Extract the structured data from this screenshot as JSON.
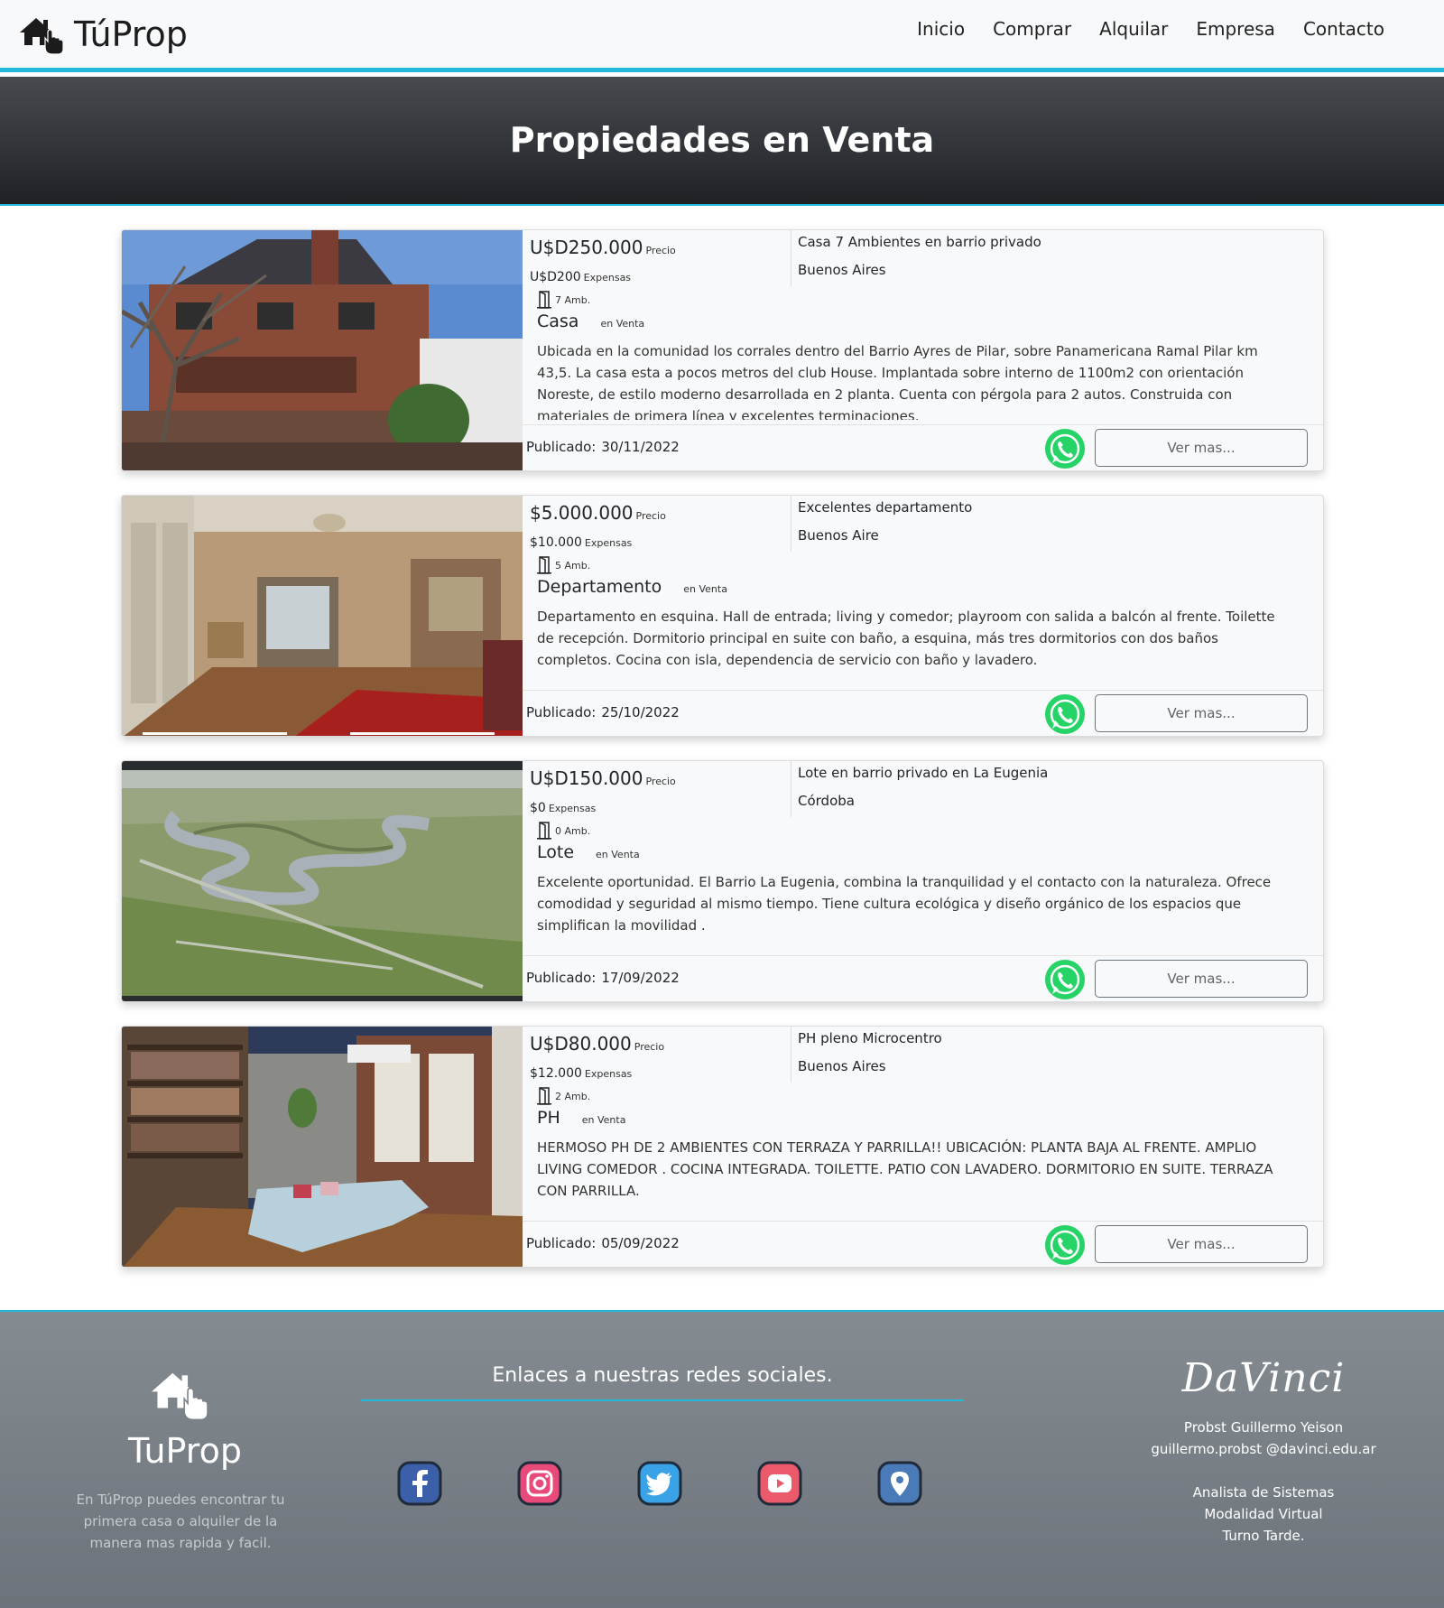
{
  "brand": {
    "name": "TúProp"
  },
  "nav": {
    "items": [
      "Inicio",
      "Comprar",
      "Alquilar",
      "Empresa",
      "Contacto"
    ]
  },
  "hero": {
    "title": "Propiedades en Venta"
  },
  "labels": {
    "precio": "Precio",
    "expensas": "Expensas",
    "publicado": "Publicado:",
    "ver_mas": "Ver mas..."
  },
  "listings": [
    {
      "price": "U$D250.000",
      "expensas": "U$D200",
      "ambientes": "7 Amb.",
      "type": "Casa",
      "status": "en Venta",
      "title": "Casa 7 Ambientes en barrio privado",
      "city": "Buenos Aires",
      "description": "Ubicada en la comunidad los corrales dentro del Barrio Ayres de Pilar, sobre Panamericana Ramal Pilar km 43,5. La casa esta a pocos metros del club House. Implantada sobre interno de 1100m2 con orientación Noreste, de estilo moderno desarrollada en 2 planta. Cuenta con pérgola para 2 autos. Construida con materiales de primera línea y excelentes terminaciones.",
      "date": "30/11/2022",
      "image": "brick-house-photo"
    },
    {
      "price": "$5.000.000",
      "expensas": "$10.000",
      "ambientes": "5 Amb.",
      "type": "Departamento",
      "status": "en Venta",
      "title": "Excelentes departamento",
      "city": "Buenos Aire",
      "description": "Departamento en esquina. Hall de entrada; living y comedor; playroom con salida a balcón al frente. Toilette de recepción. Dormitorio principal en suite con baño, a esquina, más tres dormitorios con dos baños completos. Cocina con isla, dependencia de servicio con baño y lavadero.",
      "date": "25/10/2022",
      "image": "apartment-interior-photo"
    },
    {
      "price": "U$D150.000",
      "expensas": "$0",
      "ambientes": "0 Amb.",
      "type": "Lote",
      "status": "en Venta",
      "title": "Lote en barrio privado en La Eugenia",
      "city": "Córdoba",
      "description": "Excelente oportunidad. El Barrio La Eugenia, combina la tranquilidad y el contacto con la naturaleza. Ofrece comodidad y seguridad al mismo tiempo. Tiene cultura ecológica y diseño orgánico de los espacios que simplifican la movilidad .",
      "date": "17/09/2022",
      "image": "aerial-lot-photo"
    },
    {
      "price": "U$D80.000",
      "expensas": "$12.000",
      "ambientes": "2 Amb.",
      "type": "PH",
      "status": "en Venta",
      "title": "PH pleno Microcentro",
      "city": "Buenos Aires",
      "description": "HERMOSO PH DE 2 AMBIENTES CON TERRAZA Y PARRILLA!! UBICACIÓN: PLANTA BAJA AL FRENTE. AMPLIO LIVING COMEDOR . COCINA INTEGRADA. TOILETTE. PATIO CON LAVADERO. DORMITORIO EN SUITE. TERRAZA CON PARRILLA.",
      "date": "05/09/2022",
      "image": "living-room-photo"
    }
  ],
  "footer": {
    "brand": "TuProp",
    "tagline": "En TúProp puedes encontrar tu primera casa o alquiler de la manera mas rapida y facil.",
    "social_title": "Enlaces a nuestras redes sociales.",
    "social_icons": [
      "facebook-icon",
      "instagram-icon",
      "twitter-icon",
      "youtube-icon",
      "location-icon"
    ],
    "institution": "DaVinci",
    "author": "Probst Guillermo Yeison",
    "email": "guillermo.probst @davinci.edu.ar",
    "role_lines": [
      "Analista de Sistemas",
      "Modalidad Virtual",
      "Turno Tarde."
    ]
  },
  "colors": {
    "accent": "#22b7dd",
    "whatsapp": "#25d366",
    "hero_dark": "#1f2225",
    "footer_gray": "#7a8187"
  }
}
